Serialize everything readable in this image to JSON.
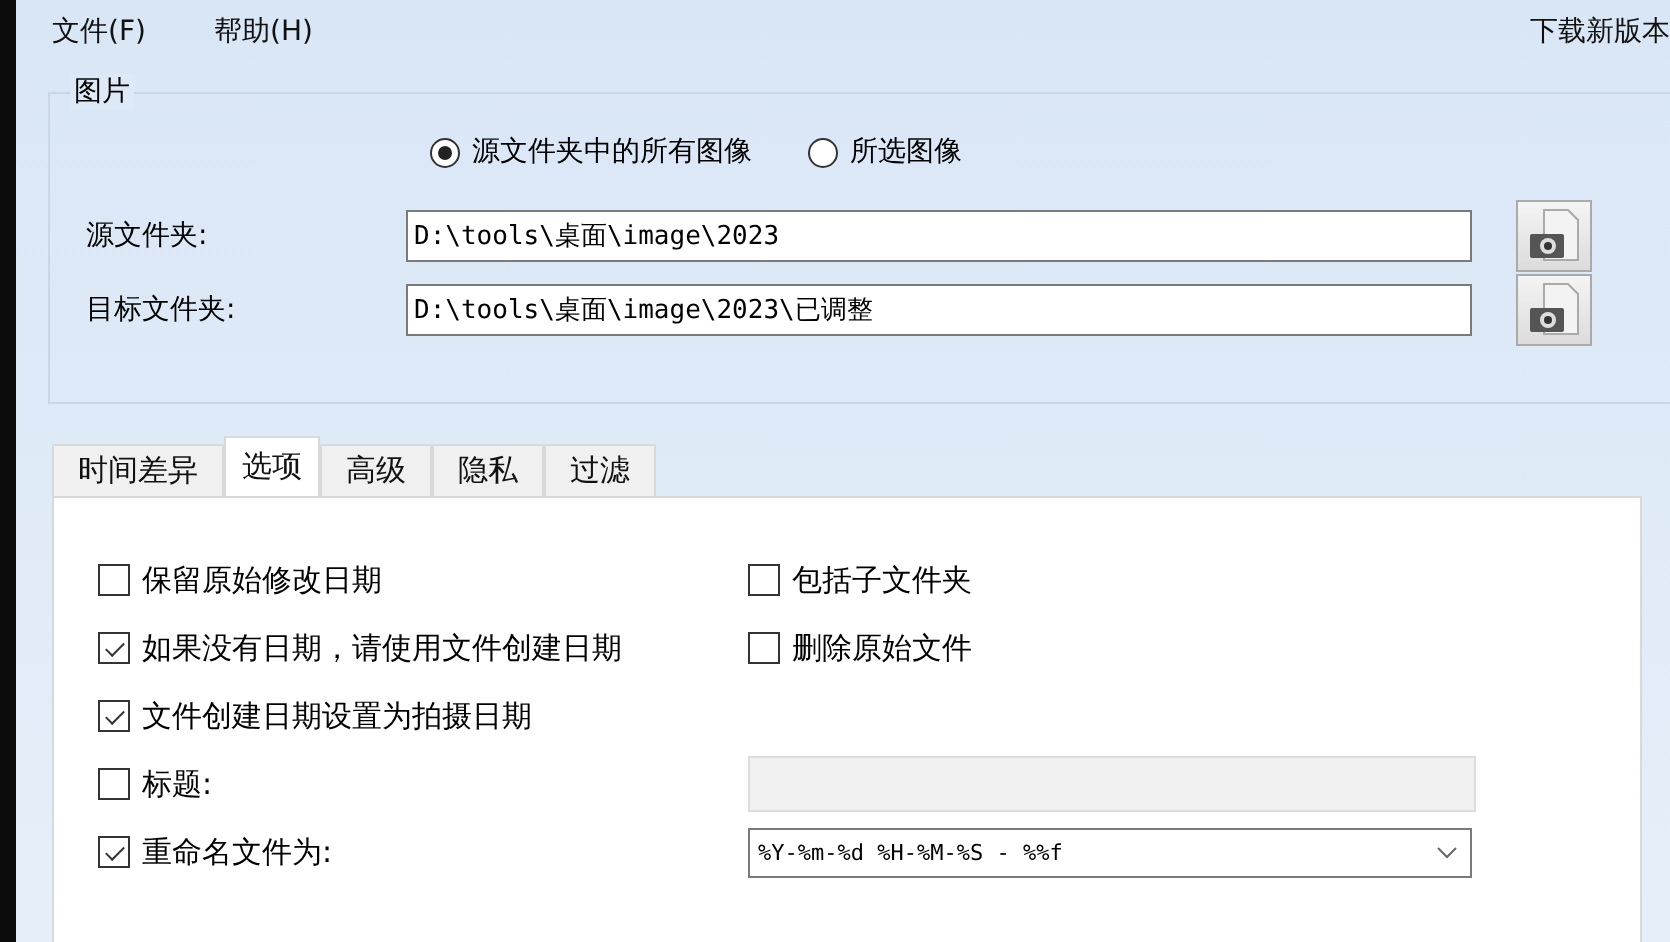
{
  "menu": [
    {
      "label": "文件(F)"
    },
    {
      "label": "帮助(H)"
    }
  ],
  "download_link": "下载新版本",
  "picture_group": {
    "title": "图片",
    "scope": [
      {
        "label": "源文件夹中的所有图像",
        "selected": true
      },
      {
        "label": "所选图像",
        "selected": false
      }
    ],
    "folders": [
      {
        "label": "源文件夹:",
        "value": "D:\\tools\\桌面\\image\\2023"
      },
      {
        "label": "目标文件夹:",
        "value": "D:\\tools\\桌面\\image\\2023\\已调整"
      }
    ]
  },
  "tabs": [
    {
      "label": "时间差异",
      "selected": false
    },
    {
      "label": "选项",
      "selected": true
    },
    {
      "label": "高级",
      "selected": false
    },
    {
      "label": "隐私",
      "selected": false
    },
    {
      "label": "过滤",
      "selected": false
    }
  ],
  "options_left": [
    {
      "label": "保留原始修改日期",
      "checked": false
    },
    {
      "label": "如果没有日期，请使用文件创建日期",
      "checked": true
    },
    {
      "label": "文件创建日期设置为拍摄日期",
      "checked": true
    }
  ],
  "options_right": [
    {
      "label": "包括子文件夹",
      "checked": false
    },
    {
      "label": "删除原始文件",
      "checked": false
    }
  ],
  "title_option": {
    "label": "标题:",
    "checked": false,
    "disabled": true
  },
  "rename_option": {
    "label": "重命名文件为:",
    "checked": true,
    "value": "%Y-%m-%d %H-%M-%S - %%f"
  }
}
